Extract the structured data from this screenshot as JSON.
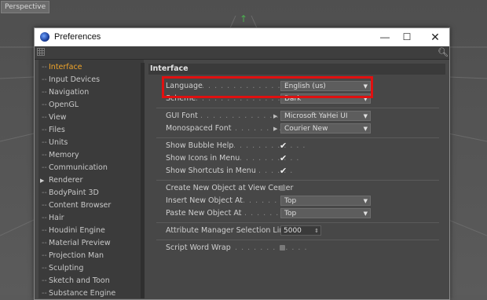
{
  "viewport": {
    "label": "Perspective"
  },
  "window": {
    "title": "Preferences",
    "controls": {
      "minimize": "—",
      "maximize": "☐",
      "close": "✕"
    }
  },
  "sidebar": {
    "items": [
      {
        "label": "Interface",
        "active": true
      },
      {
        "label": "Input Devices"
      },
      {
        "label": "Navigation"
      },
      {
        "label": "OpenGL"
      },
      {
        "label": "View"
      },
      {
        "label": "Files"
      },
      {
        "label": "Units"
      },
      {
        "label": "Memory"
      },
      {
        "label": "Communication"
      },
      {
        "label": "Renderer",
        "expandable": true
      },
      {
        "label": "BodyPaint 3D"
      },
      {
        "label": "Content Browser"
      },
      {
        "label": "Hair"
      },
      {
        "label": "Houdini Engine"
      },
      {
        "label": "Material Preview"
      },
      {
        "label": "Projection Man"
      },
      {
        "label": "Sculpting"
      },
      {
        "label": "Sketch and Toon"
      },
      {
        "label": "Substance Engine"
      }
    ]
  },
  "panel": {
    "header": "Interface",
    "language": {
      "label": "Language",
      "dots": ". . . . . . . . . . . . . . . . .",
      "value": "English (us)"
    },
    "scheme": {
      "label": "Scheme",
      "dots": ". . . . . . . . . . . . . . . . . .",
      "value": "Dark"
    },
    "gui_font": {
      "label": "GUI Font",
      "dots": ". . . . . . . . . . . . . . . . .",
      "value": "Microsoft YaHei UI"
    },
    "mono_font": {
      "label": "Monospaced Font",
      "dots": ". . . . . . . . .",
      "value": "Courier New"
    },
    "bubble_help": {
      "label": "Show Bubble Help",
      "dots": ". . . . . . . . . . . .",
      "checked": true
    },
    "icons_menu": {
      "label": "Show Icons in Menu",
      "dots": ". . . . . . . . . .",
      "checked": true
    },
    "shortcuts_menu": {
      "label": "Show Shortcuts in Menu",
      "dots": ". . . . . . .",
      "checked": true
    },
    "create_center": {
      "label": "Create New Object at View Center",
      "checked": false
    },
    "insert_at": {
      "label": "Insert New Object At",
      "dots": ". . . . . . . . .",
      "value": "Top"
    },
    "paste_at": {
      "label": "Paste New Object At",
      "dots": ". . . . . . . . . .",
      "value": "Top"
    },
    "attr_limit": {
      "label": "Attribute Manager Selection Limit",
      "value": "5000"
    },
    "word_wrap": {
      "label": "Script Word Wrap",
      "dots": ". . . . . . . . . . . . .",
      "checked": false
    }
  },
  "colors": {
    "highlight": "#e01010",
    "active_item": "#f0a52a",
    "checkmark": "#f0f0f0"
  }
}
